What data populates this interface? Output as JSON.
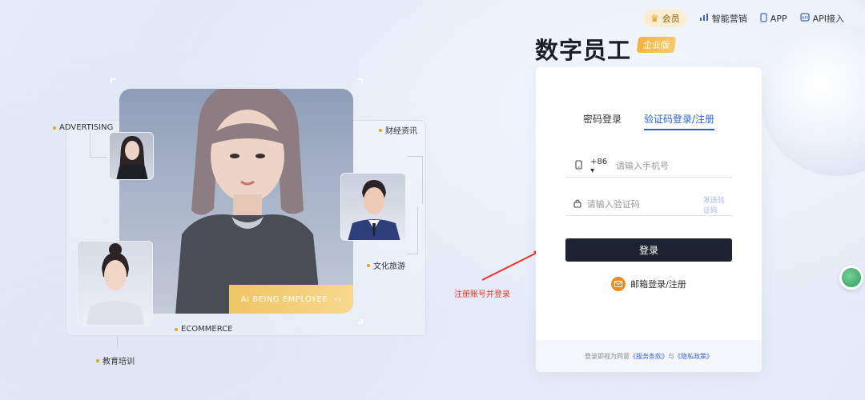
{
  "topnav": {
    "vip_label": "会员",
    "marketing_label": "智能营销",
    "app_label": "APP",
    "api_label": "API接入"
  },
  "brand": {
    "title": "数字员工",
    "badge": "企业版"
  },
  "login": {
    "tabs": [
      {
        "label": "密码登录",
        "active": false
      },
      {
        "label": "验证码登录/注册",
        "active": true
      }
    ],
    "country_code": "+86",
    "phone_placeholder": "请输入手机号",
    "code_placeholder": "请输入验证码",
    "send_code_label": "发送验证码",
    "submit_label": "登录",
    "email_login_label": "邮箱登录/注册",
    "agreement_prefix": "登录即视为同意",
    "terms_label": "《服务条款》",
    "agreement_and": "与",
    "privacy_label": "《隐私政策》"
  },
  "annotation": {
    "text": "注册账号并登录",
    "color": "#e8332b"
  },
  "hero": {
    "tag": "AI BEING EMPLOYEE",
    "tag_chevrons": "‹‹",
    "labels": {
      "advertising": "ADVERTISING",
      "finance": "财经资讯",
      "culture": "文化旅游",
      "ecommerce": "ECOMMERCE",
      "education": "教育培训"
    }
  },
  "colors": {
    "accent": "#2f5fd6",
    "button": "#1f2233",
    "gold": "#f0c464",
    "mail": "#f08c1f"
  },
  "icons": {
    "vip": "crown-icon",
    "marketing": "bar-chart-icon",
    "app": "phone-icon",
    "api": "api-icon",
    "phone_field": "mobile-icon",
    "code_field": "lock-icon",
    "email": "mail-icon"
  }
}
